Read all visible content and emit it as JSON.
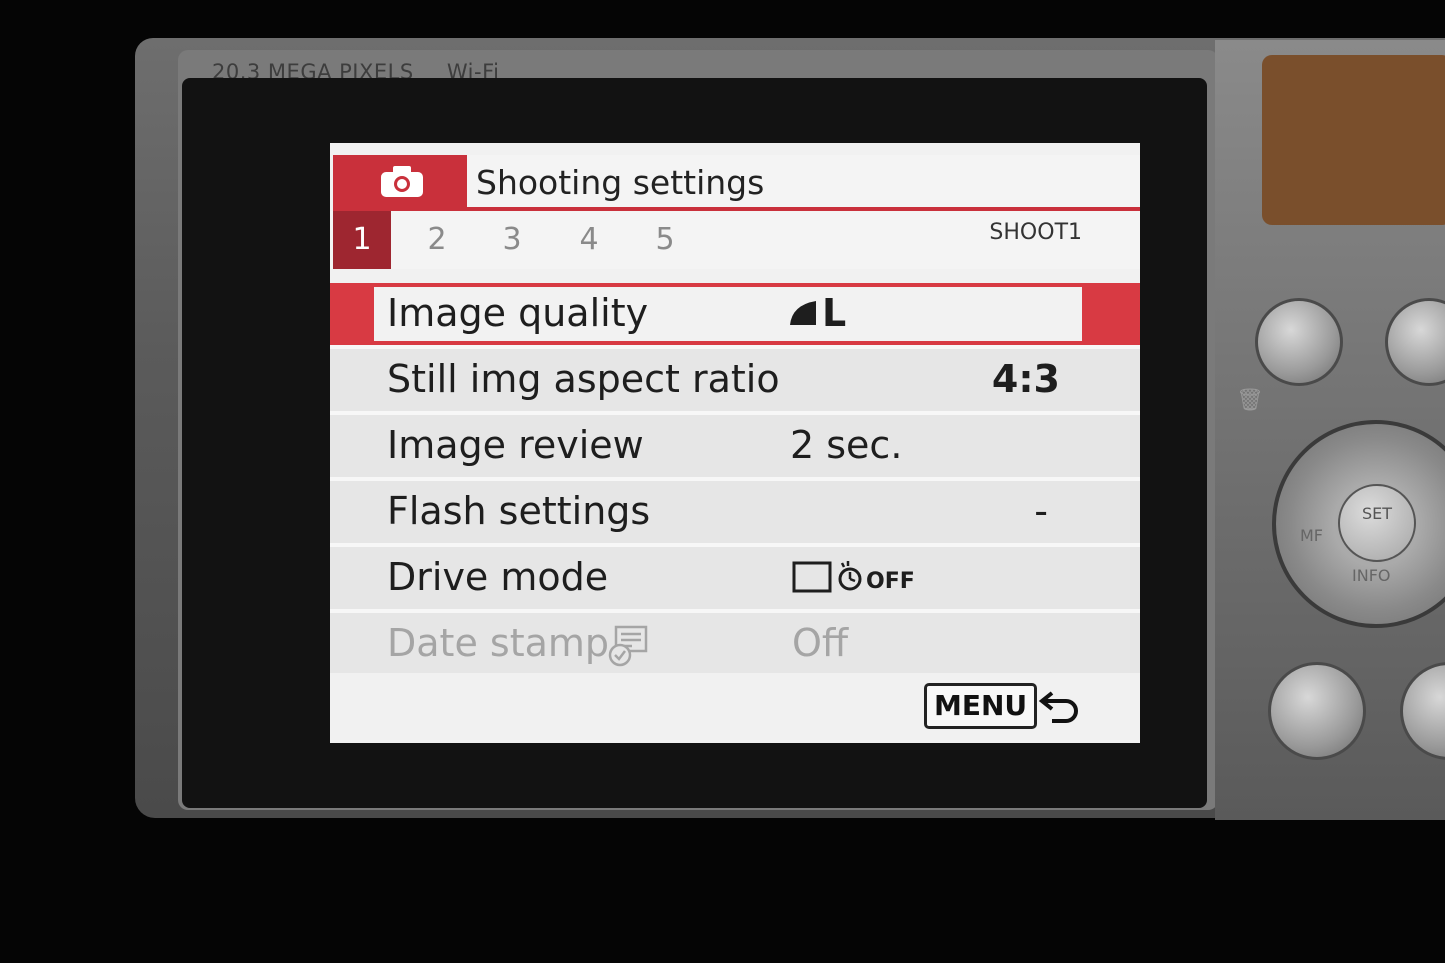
{
  "camera": {
    "bezel_labels": [
      "20.3 MEGA PIXELS",
      "Wi-Fi"
    ],
    "dial_labels": {
      "center_top": "SET",
      "bottom": "INFO",
      "left": "MF"
    }
  },
  "screen": {
    "header": {
      "icon": "camera-icon",
      "title": "Shooting settings",
      "accent_color": "#c9303b"
    },
    "tabs": [
      {
        "label": "1",
        "active": true
      },
      {
        "label": "2",
        "active": false
      },
      {
        "label": "3",
        "active": false
      },
      {
        "label": "4",
        "active": false
      },
      {
        "label": "5",
        "active": false
      }
    ],
    "tab_code": "SHOOT1",
    "menu": [
      {
        "label": "Image quality",
        "value": "L",
        "value_icon": "image-quality-large-fine-icon",
        "selected": true,
        "disabled": false
      },
      {
        "label": "Still img aspect ratio",
        "value": "4:3",
        "selected": false,
        "disabled": false
      },
      {
        "label": "Image review",
        "value": "2 sec.",
        "selected": false,
        "disabled": false
      },
      {
        "label": "Flash settings",
        "value": "-",
        "selected": false,
        "disabled": false
      },
      {
        "label": "Drive mode",
        "value_icon": "single-shot-self-timer-off-icon",
        "value_suffix": "OFF",
        "selected": false,
        "disabled": false
      },
      {
        "label": "Date stamp",
        "label_icon": "date-stamp-icon",
        "value": "Off",
        "selected": false,
        "disabled": true
      }
    ],
    "footer": {
      "menu_button": "MENU",
      "return_icon": "return-arrow-icon"
    }
  }
}
